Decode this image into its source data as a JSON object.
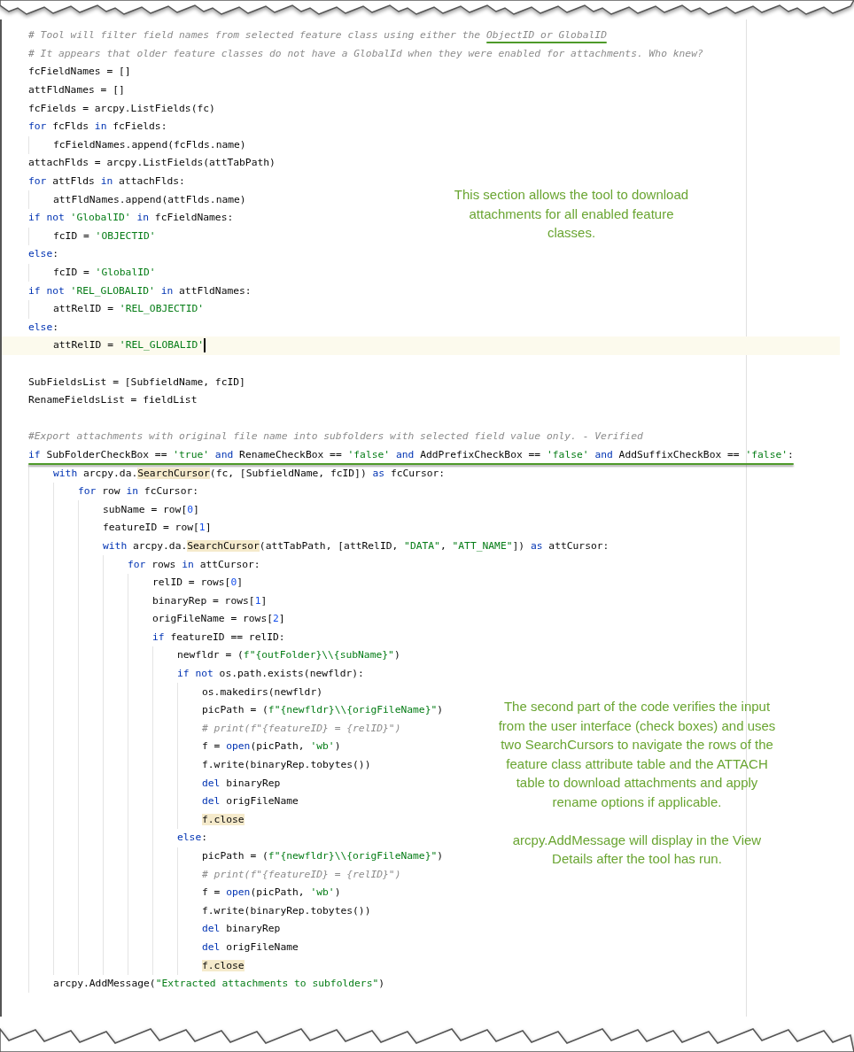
{
  "lines": [
    {
      "kind": "code",
      "segments": [
        {
          "kind": "comment",
          "text": "# Tool will filter field names from selected feature class using either the "
        },
        {
          "kind": "comment",
          "text": "ObjectID or GlobalID",
          "marked": true
        }
      ]
    },
    {
      "kind": "code",
      "segments": [
        {
          "kind": "comment",
          "text": "# It appears that older feature classes do not have a GlobalId when they were enabled for attachments. Who knew?"
        }
      ]
    },
    {
      "kind": "code",
      "segments": [
        {
          "kind": "plain",
          "text": "fcFieldNames = []"
        }
      ]
    },
    {
      "kind": "code",
      "segments": [
        {
          "kind": "plain",
          "text": "attFldNames = []"
        }
      ]
    },
    {
      "kind": "code",
      "segments": [
        {
          "kind": "plain",
          "text": "fcFields = arcpy.ListFields(fc)"
        }
      ]
    },
    {
      "kind": "code",
      "segments": [
        {
          "kind": "kw",
          "text": "for"
        },
        {
          "kind": "plain",
          "text": " fcFlds "
        },
        {
          "kind": "kw",
          "text": "in"
        },
        {
          "kind": "plain",
          "text": " fcFields:"
        }
      ],
      "children": [
        {
          "kind": "code",
          "segments": [
            {
              "kind": "plain",
              "text": "fcFieldNames.append(fcFlds.name)"
            }
          ]
        }
      ]
    },
    {
      "kind": "code",
      "segments": [
        {
          "kind": "plain",
          "text": "attachFlds = arcpy.ListFields(attTabPath)"
        }
      ]
    },
    {
      "kind": "code",
      "segments": [
        {
          "kind": "kw",
          "text": "for"
        },
        {
          "kind": "plain",
          "text": " attFlds "
        },
        {
          "kind": "kw",
          "text": "in"
        },
        {
          "kind": "plain",
          "text": " attachFlds:"
        }
      ],
      "children": [
        {
          "kind": "code",
          "segments": [
            {
              "kind": "plain",
              "text": "attFldNames.append(attFlds.name)"
            }
          ]
        }
      ]
    },
    {
      "kind": "code",
      "segments": [
        {
          "kind": "kw",
          "text": "if not "
        },
        {
          "kind": "str",
          "text": "'GlobalID'"
        },
        {
          "kind": "kw",
          "text": " in"
        },
        {
          "kind": "plain",
          "text": " fcFieldNames:"
        }
      ],
      "children": [
        {
          "kind": "code",
          "segments": [
            {
              "kind": "plain",
              "text": "fcID = "
            },
            {
              "kind": "str",
              "text": "'OBJECTID'"
            }
          ]
        }
      ]
    },
    {
      "kind": "code",
      "segments": [
        {
          "kind": "kw",
          "text": "else"
        },
        {
          "kind": "plain",
          "text": ":"
        }
      ],
      "children": [
        {
          "kind": "code",
          "segments": [
            {
              "kind": "plain",
              "text": "fcID = "
            },
            {
              "kind": "str",
              "text": "'GlobalID'"
            }
          ]
        }
      ]
    },
    {
      "kind": "code",
      "segments": [
        {
          "kind": "kw",
          "text": "if not "
        },
        {
          "kind": "str",
          "text": "'REL_GLOBALID'"
        },
        {
          "kind": "kw",
          "text": " in"
        },
        {
          "kind": "plain",
          "text": " attFldNames:"
        }
      ],
      "children": [
        {
          "kind": "code",
          "segments": [
            {
              "kind": "plain",
              "text": "attRelID = "
            },
            {
              "kind": "str",
              "text": "'REL_OBJECTID'"
            }
          ]
        }
      ]
    },
    {
      "kind": "code",
      "segments": [
        {
          "kind": "kw",
          "text": "else"
        },
        {
          "kind": "plain",
          "text": ":"
        }
      ],
      "children": [
        {
          "kind": "code",
          "current": true,
          "segments": [
            {
              "kind": "plain",
              "text": "attRelID = "
            },
            {
              "kind": "str",
              "text": "'REL_GLOBALID'"
            }
          ]
        }
      ]
    },
    {
      "kind": "blank"
    },
    {
      "kind": "code",
      "segments": [
        {
          "kind": "plain",
          "text": "SubFieldsList = [SubfieldName, fcID]"
        }
      ]
    },
    {
      "kind": "code",
      "segments": [
        {
          "kind": "plain",
          "text": "RenameFieldsList = fieldList"
        }
      ]
    },
    {
      "kind": "blank"
    },
    {
      "kind": "code",
      "segments": [
        {
          "kind": "comment",
          "text": "#Export attachments with original file name into subfolders with selected field value only. - Verified"
        }
      ]
    },
    {
      "kind": "code",
      "marked": true,
      "segments": [
        {
          "kind": "kw",
          "text": "if"
        },
        {
          "kind": "plain",
          "text": " SubFolderCheckBox == "
        },
        {
          "kind": "str",
          "text": "'true'"
        },
        {
          "kind": "kw",
          "text": " and"
        },
        {
          "kind": "plain",
          "text": " RenameCheckBox == "
        },
        {
          "kind": "str",
          "text": "'false'"
        },
        {
          "kind": "kw",
          "text": " and"
        },
        {
          "kind": "plain",
          "text": " AddPrefixCheckBox == "
        },
        {
          "kind": "str",
          "text": "'false'"
        },
        {
          "kind": "kw",
          "text": " and"
        },
        {
          "kind": "plain",
          "text": " AddSuffixCheckBox == "
        },
        {
          "kind": "str",
          "text": "'false'"
        },
        {
          "kind": "plain",
          "text": ":"
        }
      ],
      "children": [
        {
          "kind": "code",
          "segments": [
            {
              "kind": "kw",
              "text": "with"
            },
            {
              "kind": "plain",
              "text": " arcpy.da."
            },
            {
              "kind": "hl",
              "text": "SearchCursor"
            },
            {
              "kind": "plain",
              "text": "(fc, [SubfieldName, fcID]) "
            },
            {
              "kind": "kw",
              "text": "as"
            },
            {
              "kind": "plain",
              "text": " fcCursor:"
            }
          ],
          "children": [
            {
              "kind": "code",
              "segments": [
                {
                  "kind": "kw",
                  "text": "for"
                },
                {
                  "kind": "plain",
                  "text": " row "
                },
                {
                  "kind": "kw",
                  "text": "in"
                },
                {
                  "kind": "plain",
                  "text": " fcCursor:"
                }
              ],
              "children": [
                {
                  "kind": "code",
                  "segments": [
                    {
                      "kind": "plain",
                      "text": "subName = row["
                    },
                    {
                      "kind": "num",
                      "text": "0"
                    },
                    {
                      "kind": "plain",
                      "text": "]"
                    }
                  ]
                },
                {
                  "kind": "code",
                  "segments": [
                    {
                      "kind": "plain",
                      "text": "featureID = row["
                    },
                    {
                      "kind": "num",
                      "text": "1"
                    },
                    {
                      "kind": "plain",
                      "text": "]"
                    }
                  ]
                },
                {
                  "kind": "code",
                  "segments": [
                    {
                      "kind": "kw",
                      "text": "with"
                    },
                    {
                      "kind": "plain",
                      "text": " arcpy.da."
                    },
                    {
                      "kind": "hl",
                      "text": "SearchCursor"
                    },
                    {
                      "kind": "plain",
                      "text": "(attTabPath, [attRelID, "
                    },
                    {
                      "kind": "str",
                      "text": "\"DATA\""
                    },
                    {
                      "kind": "plain",
                      "text": ", "
                    },
                    {
                      "kind": "str",
                      "text": "\"ATT_NAME\""
                    },
                    {
                      "kind": "plain",
                      "text": "]) "
                    },
                    {
                      "kind": "kw",
                      "text": "as"
                    },
                    {
                      "kind": "plain",
                      "text": " attCursor:"
                    }
                  ],
                  "children": [
                    {
                      "kind": "code",
                      "segments": [
                        {
                          "kind": "kw",
                          "text": "for"
                        },
                        {
                          "kind": "plain",
                          "text": " rows "
                        },
                        {
                          "kind": "kw",
                          "text": "in"
                        },
                        {
                          "kind": "plain",
                          "text": " attCursor:"
                        }
                      ],
                      "children": [
                        {
                          "kind": "code",
                          "segments": [
                            {
                              "kind": "plain",
                              "text": "relID = rows["
                            },
                            {
                              "kind": "num",
                              "text": "0"
                            },
                            {
                              "kind": "plain",
                              "text": "]"
                            }
                          ]
                        },
                        {
                          "kind": "code",
                          "segments": [
                            {
                              "kind": "plain",
                              "text": "binaryRep = rows["
                            },
                            {
                              "kind": "num",
                              "text": "1"
                            },
                            {
                              "kind": "plain",
                              "text": "]"
                            }
                          ]
                        },
                        {
                          "kind": "code",
                          "segments": [
                            {
                              "kind": "plain",
                              "text": "origFileName = rows["
                            },
                            {
                              "kind": "num",
                              "text": "2"
                            },
                            {
                              "kind": "plain",
                              "text": "]"
                            }
                          ]
                        },
                        {
                          "kind": "code",
                          "segments": [
                            {
                              "kind": "kw",
                              "text": "if"
                            },
                            {
                              "kind": "plain",
                              "text": " featureID == relID:"
                            }
                          ],
                          "children": [
                            {
                              "kind": "code",
                              "segments": [
                                {
                                  "kind": "plain",
                                  "text": "newfldr = ("
                                },
                                {
                                  "kind": "str",
                                  "text": "f\"{outFolder}\\\\{subName}\""
                                },
                                {
                                  "kind": "plain",
                                  "text": ")"
                                }
                              ]
                            },
                            {
                              "kind": "code",
                              "segments": [
                                {
                                  "kind": "kw",
                                  "text": "if not"
                                },
                                {
                                  "kind": "plain",
                                  "text": " os.path.exists(newfldr):"
                                }
                              ],
                              "children": [
                                {
                                  "kind": "code",
                                  "segments": [
                                    {
                                      "kind": "plain",
                                      "text": "os.makedirs(newfldr)"
                                    }
                                  ]
                                },
                                {
                                  "kind": "code",
                                  "segments": [
                                    {
                                      "kind": "plain",
                                      "text": "picPath = ("
                                    },
                                    {
                                      "kind": "str",
                                      "text": "f\"{newfldr}\\\\{origFileName}\""
                                    },
                                    {
                                      "kind": "plain",
                                      "text": ")"
                                    }
                                  ]
                                },
                                {
                                  "kind": "code",
                                  "segments": [
                                    {
                                      "kind": "comment",
                                      "text": "# print(f\"{featureID} = {relID}\")"
                                    }
                                  ]
                                },
                                {
                                  "kind": "code",
                                  "segments": [
                                    {
                                      "kind": "plain",
                                      "text": "f = "
                                    },
                                    {
                                      "kind": "kw",
                                      "text": "open"
                                    },
                                    {
                                      "kind": "plain",
                                      "text": "(picPath, "
                                    },
                                    {
                                      "kind": "str",
                                      "text": "'wb'"
                                    },
                                    {
                                      "kind": "plain",
                                      "text": ")"
                                    }
                                  ]
                                },
                                {
                                  "kind": "code",
                                  "segments": [
                                    {
                                      "kind": "plain",
                                      "text": "f.write(binaryRep.tobytes())"
                                    }
                                  ]
                                },
                                {
                                  "kind": "code",
                                  "segments": [
                                    {
                                      "kind": "kw",
                                      "text": "del"
                                    },
                                    {
                                      "kind": "plain",
                                      "text": " binaryRep"
                                    }
                                  ]
                                },
                                {
                                  "kind": "code",
                                  "segments": [
                                    {
                                      "kind": "kw",
                                      "text": "del"
                                    },
                                    {
                                      "kind": "plain",
                                      "text": " origFileName"
                                    }
                                  ]
                                },
                                {
                                  "kind": "code",
                                  "segments": [
                                    {
                                      "kind": "hl",
                                      "text": "f.close"
                                    }
                                  ]
                                }
                              ]
                            },
                            {
                              "kind": "code",
                              "segments": [
                                {
                                  "kind": "kw",
                                  "text": "else"
                                },
                                {
                                  "kind": "plain",
                                  "text": ":"
                                }
                              ],
                              "children": [
                                {
                                  "kind": "code",
                                  "segments": [
                                    {
                                      "kind": "plain",
                                      "text": "picPath = ("
                                    },
                                    {
                                      "kind": "str",
                                      "text": "f\"{newfldr}\\\\{origFileName}\""
                                    },
                                    {
                                      "kind": "plain",
                                      "text": ")"
                                    }
                                  ]
                                },
                                {
                                  "kind": "code",
                                  "segments": [
                                    {
                                      "kind": "comment",
                                      "text": "# print(f\"{featureID} = {relID}\")"
                                    }
                                  ]
                                },
                                {
                                  "kind": "code",
                                  "segments": [
                                    {
                                      "kind": "plain",
                                      "text": "f = "
                                    },
                                    {
                                      "kind": "kw",
                                      "text": "open"
                                    },
                                    {
                                      "kind": "plain",
                                      "text": "(picPath, "
                                    },
                                    {
                                      "kind": "str",
                                      "text": "'wb'"
                                    },
                                    {
                                      "kind": "plain",
                                      "text": ")"
                                    }
                                  ]
                                },
                                {
                                  "kind": "code",
                                  "segments": [
                                    {
                                      "kind": "plain",
                                      "text": "f.write(binaryRep.tobytes())"
                                    }
                                  ]
                                },
                                {
                                  "kind": "code",
                                  "segments": [
                                    {
                                      "kind": "kw",
                                      "text": "del"
                                    },
                                    {
                                      "kind": "plain",
                                      "text": " binaryRep"
                                    }
                                  ]
                                },
                                {
                                  "kind": "code",
                                  "segments": [
                                    {
                                      "kind": "kw",
                                      "text": "del"
                                    },
                                    {
                                      "kind": "plain",
                                      "text": " origFileName"
                                    }
                                  ]
                                },
                                {
                                  "kind": "code",
                                  "segments": [
                                    {
                                      "kind": "hl",
                                      "text": "f.close"
                                    }
                                  ]
                                }
                              ]
                            }
                          ]
                        }
                      ]
                    }
                  ]
                }
              ]
            }
          ]
        },
        {
          "kind": "code",
          "segments": [
            {
              "kind": "plain",
              "text": "arcpy.AddMessage("
            },
            {
              "kind": "str",
              "text": "\"Extracted attachments to subfolders\""
            },
            {
              "kind": "plain",
              "text": ")"
            }
          ]
        }
      ]
    }
  ],
  "annotations": [
    {
      "paragraphs": [
        "This section allows the tool to download attachments for all enabled feature classes."
      ]
    },
    {
      "paragraphs": [
        "The second part of the code verifies the input from the user interface (check boxes) and uses two SearchCursors to navigate the rows of the feature class attribute table and the ATTACH table to download attachments and apply rename options if applicable.",
        "arcpy.AddMessage will display in the View Details after the tool has run."
      ]
    }
  ]
}
